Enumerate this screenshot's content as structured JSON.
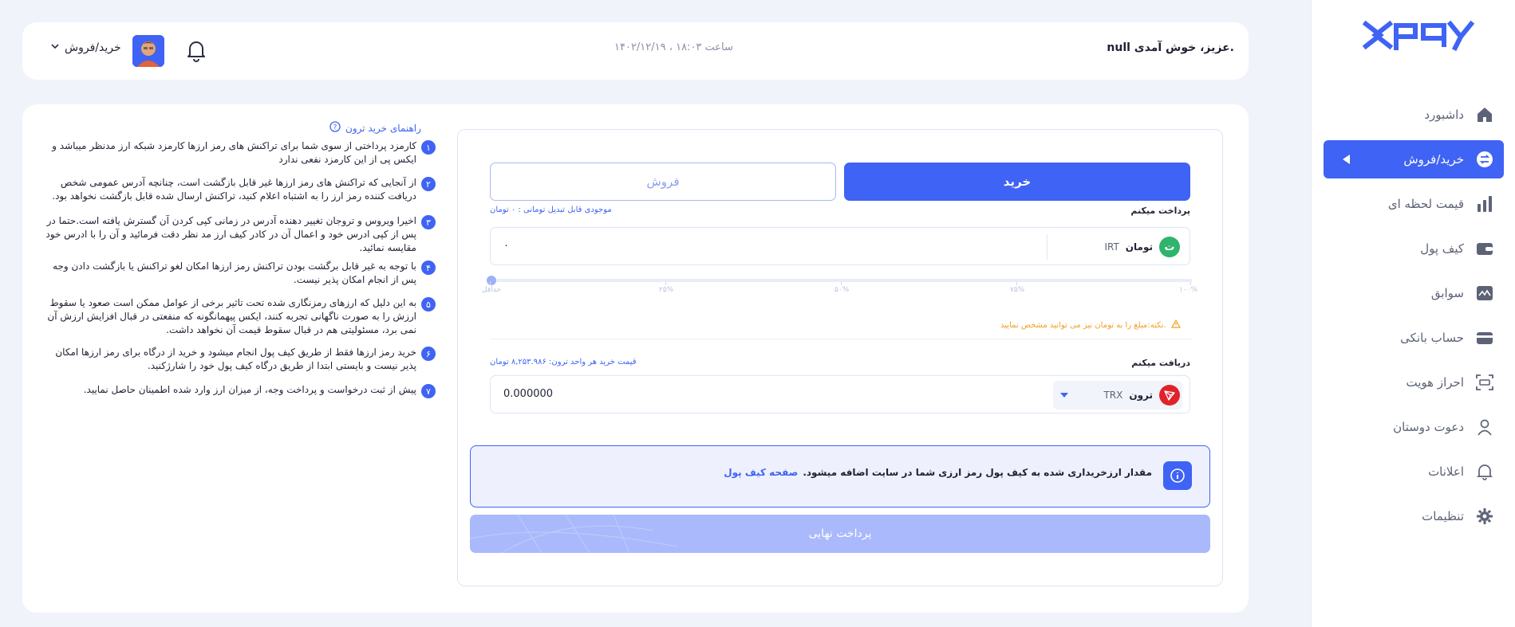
{
  "sidebar": {
    "logo": "xpay",
    "items": [
      {
        "label": "داشبورد",
        "icon": "home-icon"
      },
      {
        "label": "خرید/فروش",
        "icon": "exchange-icon",
        "active": true
      },
      {
        "label": "قیمت لحظه ای",
        "icon": "bar-chart-icon"
      },
      {
        "label": "کیف پول",
        "icon": "wallet-icon"
      },
      {
        "label": "سوابق",
        "icon": "history-icon"
      },
      {
        "label": "حساب بانکی",
        "icon": "card-icon"
      },
      {
        "label": "احراز هویت",
        "icon": "id-scan-icon"
      },
      {
        "label": "دعوت دوستان",
        "icon": "user-icon"
      },
      {
        "label": "اعلانات",
        "icon": "bell-icon"
      },
      {
        "label": "تنظیمات",
        "icon": "gear-icon"
      }
    ]
  },
  "header": {
    "welcome": "null عزیز، خوش آمدی.",
    "datetime": "۱۴۰۲/۱۲/۱۹ ، ساعت ۱۸:۰۳",
    "user_menu_label": "خرید/فروش"
  },
  "guide": {
    "title": "راهنمای خرید ترون",
    "items": [
      {
        "num": "۱",
        "text": "کارمزد پرداختی از سوی شما برای تراکنش های رمز ارزها کارمزد شبکه ارز مدنظر میباشد و ایکس پی از این کارمزد نفعی ندارد"
      },
      {
        "num": "۲",
        "text": "از آنجایی که تراکنش های رمز ارزها غیر قابل بازگشت است، چنانچه آدرس عمومی شخص دریافت کننده رمز ارز را به اشتباه اعلام کنید، تراکنش ارسال شده قابل بازگشت نخواهد بود."
      },
      {
        "num": "۳",
        "text": "اخیرا ویروس و تروجان تغییر دهنده آدرس در زمانی کپی کردن آن گسترش یافته است.حتما در پس از کپی ادرس خود و اعمال آن در کادر کیف ارز مد نظر دقت فرمائید و آن را با ادرس خود مقایسه نمائید."
      },
      {
        "num": "۴",
        "text": "با توجه به غیر قابل برگشت بودن تراکنش رمز ارزها امکان لغو تراکنش یا بازگشت دادن وجه پس از انجام امکان پذیر نیست."
      },
      {
        "num": "۵",
        "text": "به این دلیل که ارزهای رمزنگاری شده تحت تاثیر برخی از عوامل ممکن است صعود یا سقوط ارزش را به صورت ناگهانی تجربه کنند، ایکس پیهمانگونه که منفعتی در قبال افزایش ارزش آن نمی برد، مسئولیتی هم در قبال سقوط قیمت آن نخواهد داشت."
      },
      {
        "num": "۶",
        "text": "خرید رمز ارزها فقط از طریق کیف پول انجام میشود و خرید از درگاه برای رمز ارزها امکان پذیر نیست و بایستی ابتدا از طریق درگاه کیف پول خود را شارژکنید."
      },
      {
        "num": "۷",
        "text": "پیش از ثبت درخواست و پرداخت وجه، از میزان ارز وارد شده اطمینان حاصل نمایید."
      }
    ]
  },
  "form": {
    "tab_buy": "خرید",
    "tab_sell": "فروش",
    "pay_label": "پرداخت میکنم",
    "balance_hint": "موجودی قابل تبدیل تومانی : ۰ تومان",
    "pay_currency_name": "تومان",
    "pay_currency_code": "IRT",
    "pay_value": "۰",
    "slider_percent": 0,
    "slider_labels": [
      "حداقل",
      "۲۵%",
      "۵۰%",
      "۷۵%",
      "۱۰۰%"
    ],
    "note": "نکته:مبلغ را به تومان نیز می توانید مشخص نمایید.",
    "receive_label": "دریافت میکنم",
    "price_hint": "قیمت خرید هر واحد ترون: ۸,۲۵۳.۹۸۶ تومان",
    "receive_currency_name": "ترون",
    "receive_currency_code": "TRX",
    "receive_value": "0.000000",
    "info_text": "مقدار ارزخریداری شده به کیف پول رمز ارزی شما در سایت اضافه میشود.",
    "info_link": "صفحه کیف پول",
    "submit": "پرداخت نهایی"
  },
  "colors": {
    "accent": "#3f63f4",
    "tron": "#e0232b",
    "toman": "#2fb36d",
    "warning": "#f0a020"
  }
}
